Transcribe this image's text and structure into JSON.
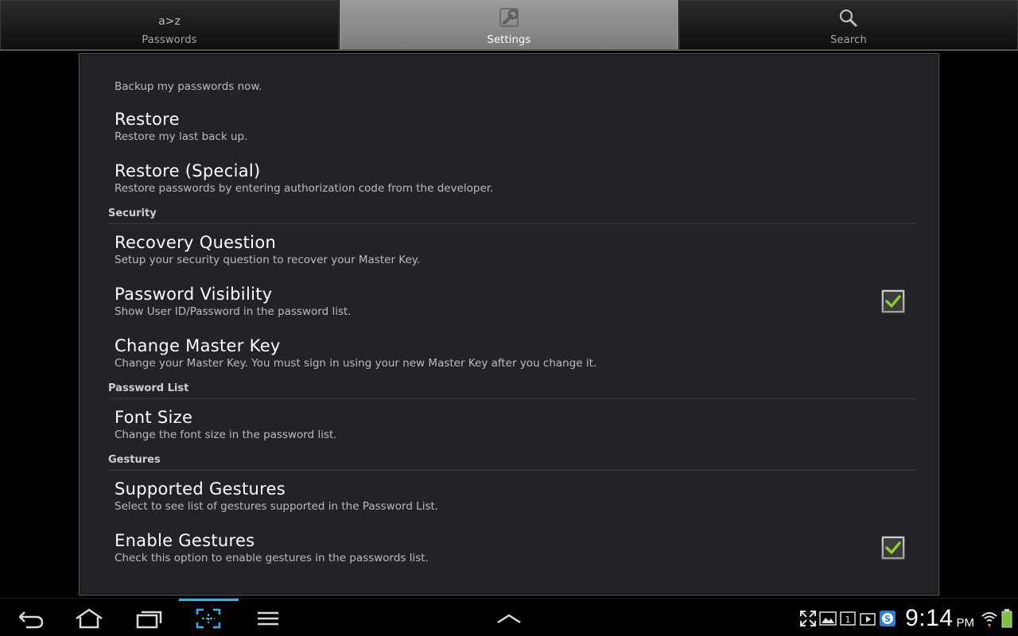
{
  "tabs": [
    {
      "label": "Passwords",
      "icon_text": "a>z",
      "icon": "az-sort-icon",
      "selected": false
    },
    {
      "label": "Settings",
      "icon": "wrench-icon",
      "selected": true
    },
    {
      "label": "Search",
      "icon": "search-icon",
      "selected": false
    }
  ],
  "settings": {
    "backup_summary": "Backup my passwords now.",
    "restore": {
      "title": "Restore",
      "summary": "Restore my last back up."
    },
    "restore_special": {
      "title": "Restore (Special)",
      "summary": "Restore passwords by entering authorization code from the developer."
    },
    "security_category": "Security",
    "recovery_question": {
      "title": "Recovery Question",
      "summary": "Setup your security question to recover your Master Key."
    },
    "password_visibility": {
      "title": "Password Visibility",
      "summary": "Show User ID/Password in the password list.",
      "checked": true
    },
    "change_master_key": {
      "title": "Change Master Key",
      "summary": "Change your Master Key. You must sign in using your new Master Key after you change it."
    },
    "password_list_category": "Password List",
    "font_size": {
      "title": "Font Size",
      "summary": "Change the font size in the password list."
    },
    "gestures_category": "Gestures",
    "supported_gestures": {
      "title": "Supported Gestures",
      "summary": "Select to see list of gestures supported in the Password List."
    },
    "enable_gestures": {
      "title": "Enable Gestures",
      "summary": "Check this option to enable gestures in the passwords list.",
      "checked": true
    }
  },
  "status_bar": {
    "time": "9:14",
    "ampm": "PM",
    "accent_color": "#33b5e5",
    "check_color": "#8bd12a"
  }
}
